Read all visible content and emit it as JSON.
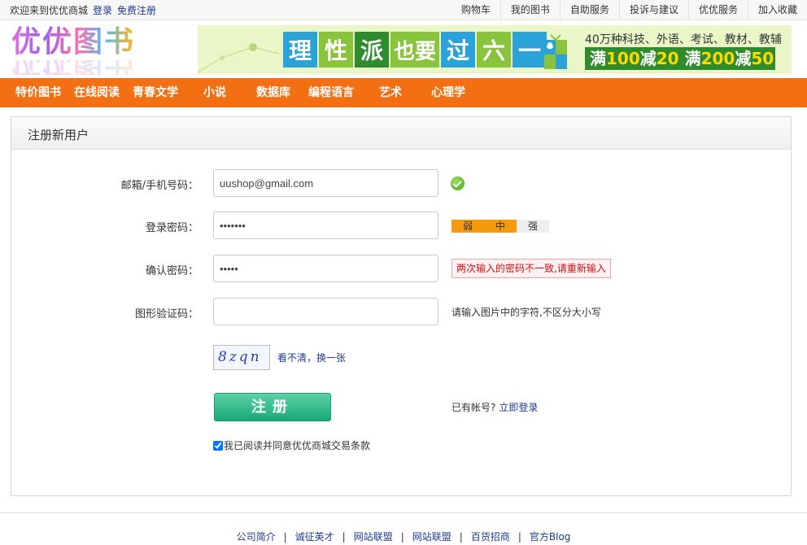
{
  "topbar": {
    "welcome": "欢迎来到优优商城",
    "login": "登录",
    "register": "免费注册",
    "links": [
      "购物车",
      "我的图书",
      "自助服务",
      "投诉与建议",
      "优优服务",
      "加入收藏"
    ]
  },
  "logo": {
    "text": "优优图书"
  },
  "banner": {
    "tiles": [
      "理",
      "性",
      "派",
      "也要",
      "过",
      "六",
      "一"
    ],
    "tile_colors": [
      "#2ba3d9",
      "#8ac43d",
      "#2f8c2c",
      "#8ac43d",
      "#2ba3d9",
      "#8ac43d",
      "#2ba3d9"
    ],
    "tagline": "40万种科技、外语、考试、教材、教辅",
    "promo": {
      "a": "满",
      "a_num": "100",
      "b": "减",
      "b_num": "20",
      "c": "满",
      "c_num": "200",
      "d": "减",
      "d_num": "50"
    }
  },
  "nav": {
    "items": [
      "特价图书",
      "在线阅读",
      "青春文学",
      "小说",
      "数据库",
      "编程语言",
      "艺术",
      "心理学"
    ]
  },
  "form": {
    "title": "注册新用户",
    "email_label": "邮箱/手机号码：",
    "email_value": "uushop@gmail.com",
    "password_label": "登录密码：",
    "password_value": "•••••••",
    "confirm_label": "确认密码：",
    "confirm_value": "•••••",
    "captcha_label": "图形验证码：",
    "captcha_value": "",
    "strength": [
      "弱",
      "中",
      "强"
    ],
    "strength_level": 2,
    "confirm_error": "两次输入的密码不一致,请重新输入",
    "captcha_hint": "请输入图片中的字符,不区分大小写",
    "captcha_text": "8zqn",
    "captcha_refresh": "看不清，换一张",
    "submit_label": "注册",
    "has_account": "已有帐号?",
    "login_now": "立即登录",
    "agree_text": "我已阅读并同意优优商城交易条款",
    "agree_checked": true
  },
  "footer": {
    "links": [
      "公司简介",
      "诚征英才",
      "网站联盟",
      "网站联盟",
      "百货招商",
      "官方Blog"
    ]
  },
  "colors": {
    "nav_bg": "#f26f13",
    "strength_on": "#f59a0f",
    "submit_green": "#1aa877"
  }
}
